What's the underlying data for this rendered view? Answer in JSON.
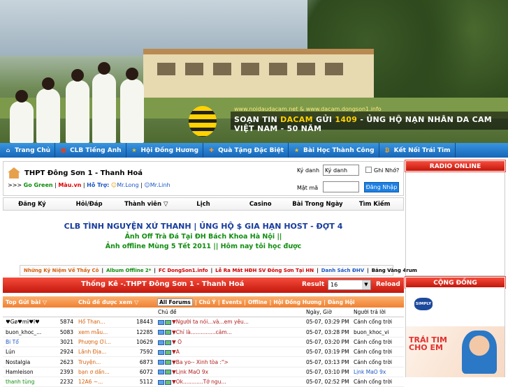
{
  "banner": {
    "url_text": "www.noidaudacam.net & www.dacam.dongson1.info",
    "slogan_pre": "SOẠN TIN",
    "slogan_dacam": "DACAM",
    "slogan_gui": "GỬI",
    "slogan_num": "1409",
    "slogan_post": "- ỦNG HỘ NẠN NHÂN DA CAM VIỆT NAM - 50 NĂM"
  },
  "nav": {
    "items": [
      {
        "label": "Trang Chủ",
        "icon": "home-icon",
        "color": "#f2f2f2"
      },
      {
        "label": "CLB Tiếng Anh",
        "icon": "book-icon",
        "color": "#d9442b"
      },
      {
        "label": "Hội Đồng Hương",
        "icon": "star-icon",
        "color": "#f5c71a"
      },
      {
        "label": "Quà Tặng Đặc Biệt",
        "icon": "gift-icon",
        "color": "#ff9a2e"
      },
      {
        "label": "Bài Học Thành Công",
        "icon": "star-icon",
        "color": "#f5c71a"
      },
      {
        "label": "Kết Nối Trái Tim",
        "icon": "coin-icon",
        "color": "#f7a21b"
      }
    ]
  },
  "site": {
    "title": "THPT Đông Sơn 1 - Thanh Hoá",
    "prefix": ">>>",
    "green": "Go Green",
    "sep1": " | ",
    "mau": "Màu.vn",
    "sep2": " | ",
    "support": "Hỗ Trợ:",
    "s1": "Mr.Long",
    "sep3": " | ",
    "s2": "Mr.Linh"
  },
  "login": {
    "user_label": "Ký danh",
    "user_value": "Ký danh",
    "remember": "Ghi Nhớ?",
    "pass_label": "Mật mã",
    "button": "Đăng Nhập"
  },
  "menu2": [
    "Đăng Ký",
    "Hỏi/Đáp",
    "Thành viên ▽",
    "Lịch",
    "Casino",
    "Bài Trong Ngày",
    "Tìm Kiếm"
  ],
  "notice": {
    "n1": "CLB TÌNH NGUYỆN XỨ THANH | ỦNG HỘ $ GIA HẠN HOST - ĐỢT 4",
    "n2": "Ảnh Off Trà Đá Tại ĐH Bách Khoa Hà Nội ||",
    "n3": "Ảnh offline Mùng 5 Tết 2011 || Hôm nay tôi học được"
  },
  "links": [
    {
      "text": "Những Kỷ Niệm Về Thầy Cô",
      "color": "#d5600c"
    },
    {
      "text": "|",
      "color": "#000000"
    },
    {
      "text": "Album Offline 2*",
      "color": "#118d11"
    },
    {
      "text": "|",
      "color": "#000000"
    },
    {
      "text": "FC DongSon1.info",
      "color": "#d00000"
    },
    {
      "text": "|",
      "color": "#000000"
    },
    {
      "text": "Lễ Ra Mắt HĐH SV Đông Sơn Tại HN",
      "color": "#d00000"
    },
    {
      "text": "|",
      "color": "#000000"
    },
    {
      "text": "Danh Sách ĐHV",
      "color": "#1a56c4"
    },
    {
      "text": "|",
      "color": "#000000"
    },
    {
      "text": "Bảng Vàng 4rum",
      "color": "#000000"
    }
  ],
  "stats": {
    "title": "Thống Kê -.THPT Đông Sơn 1 - Thanh Hoá",
    "result_label": "Result",
    "result_value": "16",
    "reload": "Reload"
  },
  "table": {
    "h_top": "Top Gửi bài ▽",
    "h_topic": "Chủ đề được xem ▽",
    "tabs": [
      "All Forums",
      "|",
      "Chú Ý",
      "|",
      "Events",
      "|",
      "Offline",
      "|",
      "Hội Đồng Hương",
      "|",
      "Đàng Hội"
    ],
    "sub_topic": "Chủ đề",
    "sub_date": "Ngày, Giờ",
    "sub_last": "Người trả lời",
    "rows": [
      {
        "u": "♥Gø♥mï♥ï♥",
        "p": "5874",
        "t": "Hổ Than...",
        "v": "18443",
        "s": "▼Người ta nói...và...em yêu...",
        "d": "05-07, 03:29 PM",
        "l": "Cánh cổng trời",
        "uc": "#000000",
        "lc": "#000000"
      },
      {
        "u": "buon_khoc_...",
        "p": "5083",
        "t": "xem mẫu...",
        "v": "12285",
        "s": "▼Chỉ là...............cảm...",
        "d": "05-07, 03:28 PM",
        "l": "buon_khoc_vi",
        "uc": "#000000",
        "lc": "#000000"
      },
      {
        "u": "Bi Tổ",
        "p": "3021",
        "t": "Phượng Ơi...",
        "v": "10629",
        "s": "▼ Ô",
        "d": "05-07, 03:20 PM",
        "l": "Cánh cổng trời",
        "uc": "#1a56c4",
        "lc": "#000000"
      },
      {
        "u": "Lún",
        "p": "2924",
        "t": "Lãnh Địa...",
        "v": "7592",
        "s": "▼A",
        "d": "05-07, 03:19 PM",
        "l": "Cánh cổng trời",
        "uc": "#000000",
        "lc": "#000000"
      },
      {
        "u": "Nostalgia",
        "p": "2623",
        "t": "Truyện...",
        "v": "6873",
        "s": "▼Ba yo-- Xinh tòa :\">",
        "d": "05-07, 03:13 PM",
        "l": "Cánh cổng trời",
        "uc": "#000000",
        "lc": "#000000"
      },
      {
        "u": "Hamleison",
        "p": "2393",
        "t": "bạn ơ dần...",
        "v": "6072",
        "s": "▼Lịnk MaO 9x",
        "d": "05-07, 03:10 PM",
        "l": "Lịnk MaO 9x",
        "uc": "#000000",
        "lc": "#1a56c4"
      },
      {
        "u": "thanh tùng",
        "p": "2232",
        "t": "12A6 ~...",
        "v": "5112",
        "s": "▼Ok............Tớ ngu...",
        "d": "05-07, 02:52 PM",
        "l": "Cánh cổng trời",
        "uc": "#118d11",
        "lc": "#000000"
      }
    ]
  },
  "right": {
    "radio": "RADIO ONLINE",
    "community": "CỘNG ĐỒNG",
    "logo_text": "SIMPLY",
    "ad_line1": "TRÁI TIM",
    "ad_line2": "CHO EM"
  }
}
